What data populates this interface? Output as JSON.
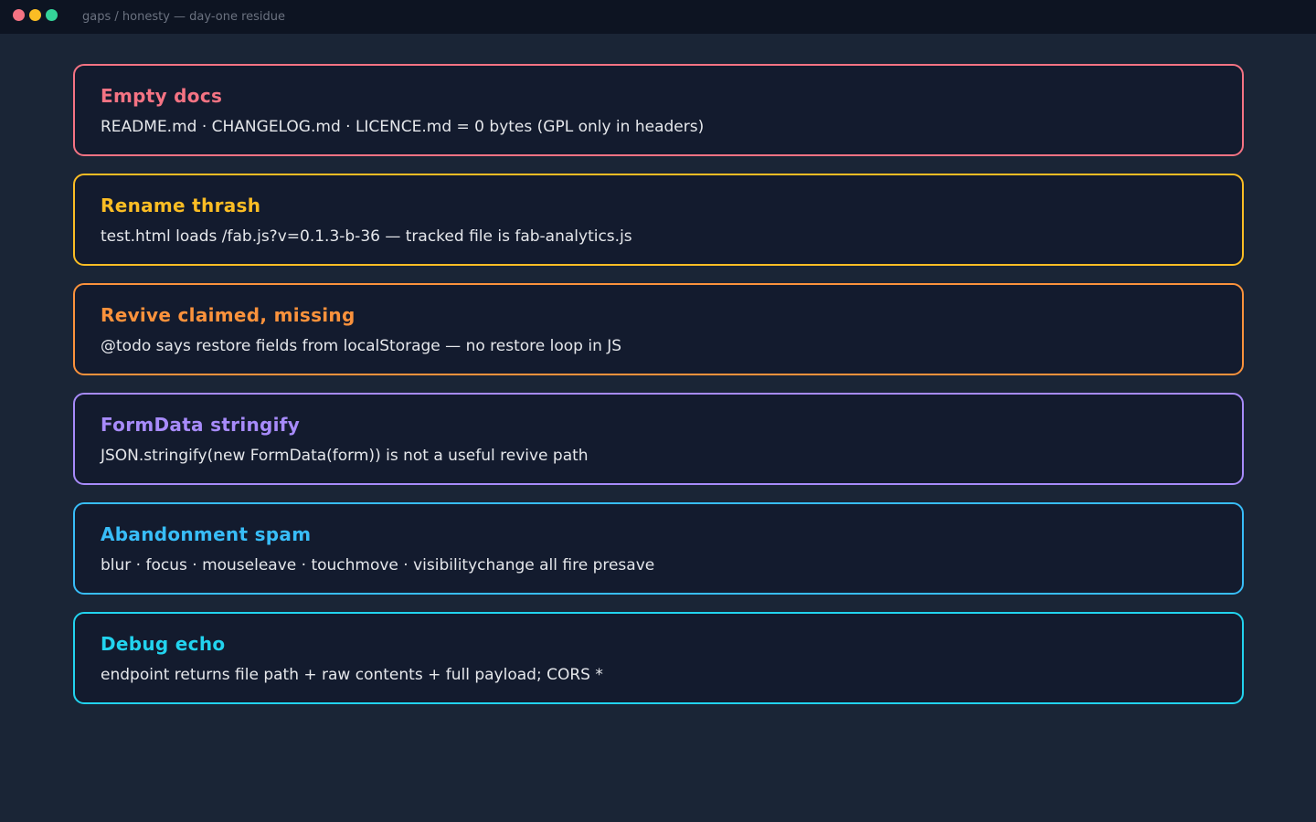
{
  "window": {
    "title": "gaps / honesty — day-one residue",
    "controls": [
      {
        "name": "close",
        "color": "#f47383"
      },
      {
        "name": "minimize",
        "color": "#fbbd24"
      },
      {
        "name": "maximize",
        "color": "#34d399"
      }
    ]
  },
  "cards": [
    {
      "title": "Empty docs",
      "body": "README.md · CHANGELOG.md · LICENCE.md = 0 bytes (GPL only in headers)",
      "color": "#f47383"
    },
    {
      "title": "Rename thrash",
      "body": "test.html loads /fab.js?v=0.1.3-b-36 — tracked file is fab-analytics.js",
      "color": "#fbbd24"
    },
    {
      "title": "Revive claimed, missing",
      "body": "@todo says restore fields from localStorage — no restore loop in JS",
      "color": "#fb923c"
    },
    {
      "title": "FormData stringify",
      "body": "JSON.stringify(new FormData(form)) is not a useful revive path",
      "color": "#a78bfa"
    },
    {
      "title": "Abandonment spam",
      "body": "blur · focus · mouseleave · touchmove · visibilitychange all fire presave",
      "color": "#38bdf8"
    },
    {
      "title": "Debug echo",
      "body": "endpoint returns file path + raw contents + full payload; CORS *",
      "color": "#22d3ee"
    }
  ]
}
